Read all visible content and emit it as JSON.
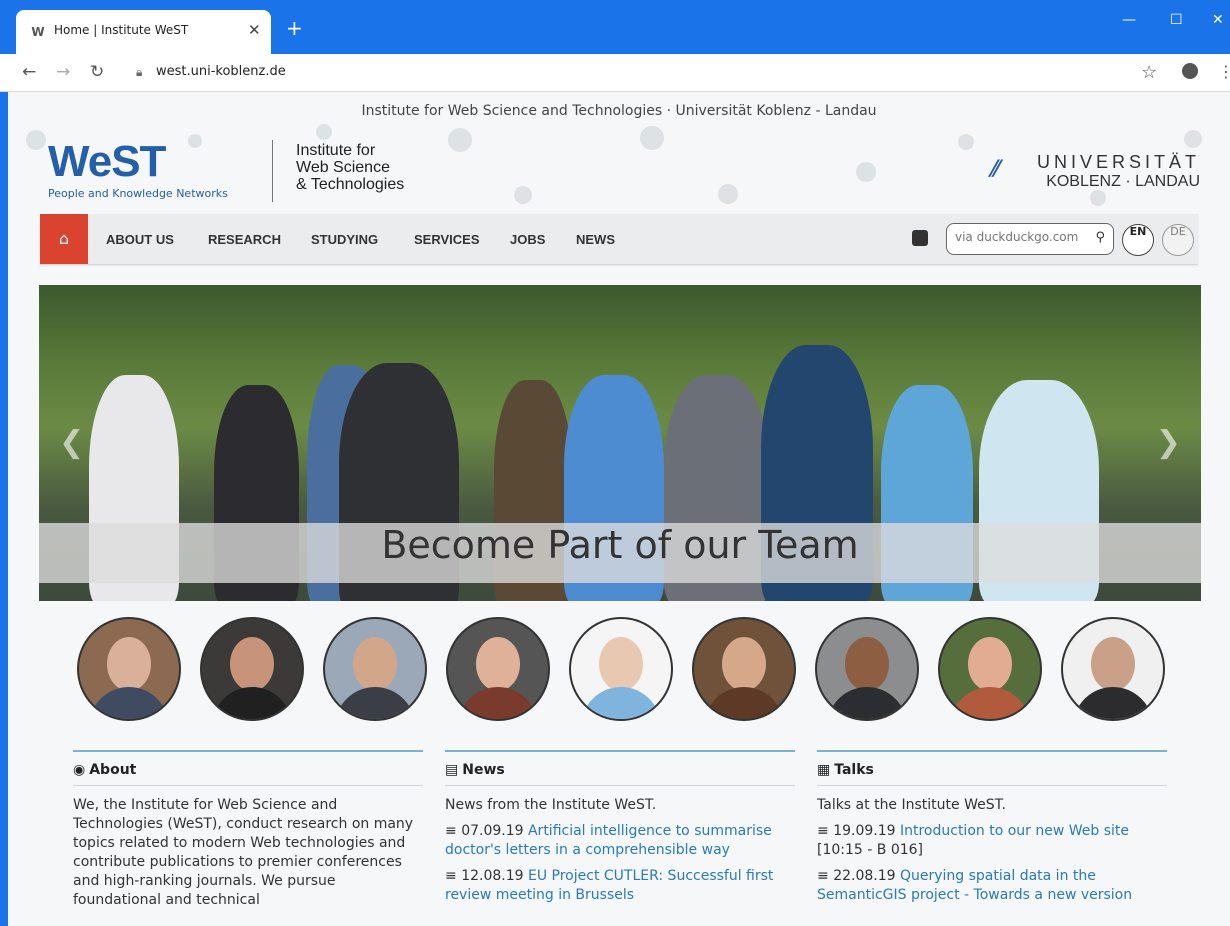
{
  "browser": {
    "tab_title": "Home | Institute WeST",
    "tab_favicon": "W",
    "url": "west.uni-koblenz.de"
  },
  "site": {
    "topline": "Institute for Web Science and Technologies · Universität Koblenz - Landau",
    "logo_text": "WeST",
    "logo_sub": "People and Knowledge Networks",
    "inst_line1": "Institute for",
    "inst_line2": "Web Science",
    "inst_line3": "& Technologies",
    "uni_line1": "UNIVERSITÄT",
    "uni_line2": "KOBLENZ · LANDAU",
    "nav": [
      "ABOUT US",
      "RESEARCH",
      "STUDYING",
      "SERVICES",
      "JOBS",
      "NEWS"
    ],
    "search_placeholder": "via duckduckgo.com",
    "lang_en": "EN",
    "lang_de": "DE",
    "hero_caption": "Become Part of our Team"
  },
  "columns": {
    "about": {
      "title": "About",
      "text": "We, the Institute for Web Science and Technologies (WeST), conduct research on many topics related to modern Web technologies and contribute publications to premier conferences and high-ranking journals. We pursue foundational and technical"
    },
    "news": {
      "title": "News",
      "intro": "News from the Institute WeST.",
      "items": [
        {
          "date": "07.09.19",
          "text": "Artificial intelligence to summarise doctor's letters in a comprehensible way"
        },
        {
          "date": "12.08.19",
          "text": "EU Project CUTLER: Successful first review meeting in Brussels"
        }
      ]
    },
    "talks": {
      "title": "Talks",
      "intro": "Talks at the Institute WeST.",
      "items": [
        {
          "date": "19.09.19",
          "text": "Introduction to our new Web site",
          "extra": "[10:15 - B 016]"
        },
        {
          "date": "22.08.19",
          "text": "Querying spatial data in the SemanticGIS project - Towards a new version",
          "extra": ""
        }
      ]
    }
  }
}
